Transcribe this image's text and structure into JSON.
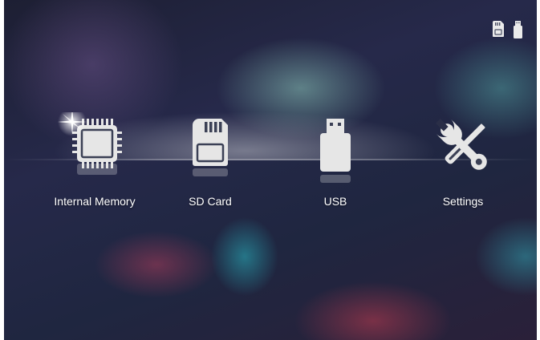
{
  "status_bar": {
    "icons": [
      "sd-card-icon",
      "usb-icon"
    ]
  },
  "menu": {
    "items": [
      {
        "label": "Internal Memory",
        "icon": "memory-chip-icon",
        "selected": true
      },
      {
        "label": "SD Card",
        "icon": "sd-card-icon",
        "selected": false
      },
      {
        "label": "USB",
        "icon": "usb-icon",
        "selected": false
      },
      {
        "label": "Settings",
        "icon": "tools-icon",
        "selected": false
      }
    ]
  },
  "colors": {
    "icon": "#e8e8e8",
    "text": "#ffffff"
  }
}
